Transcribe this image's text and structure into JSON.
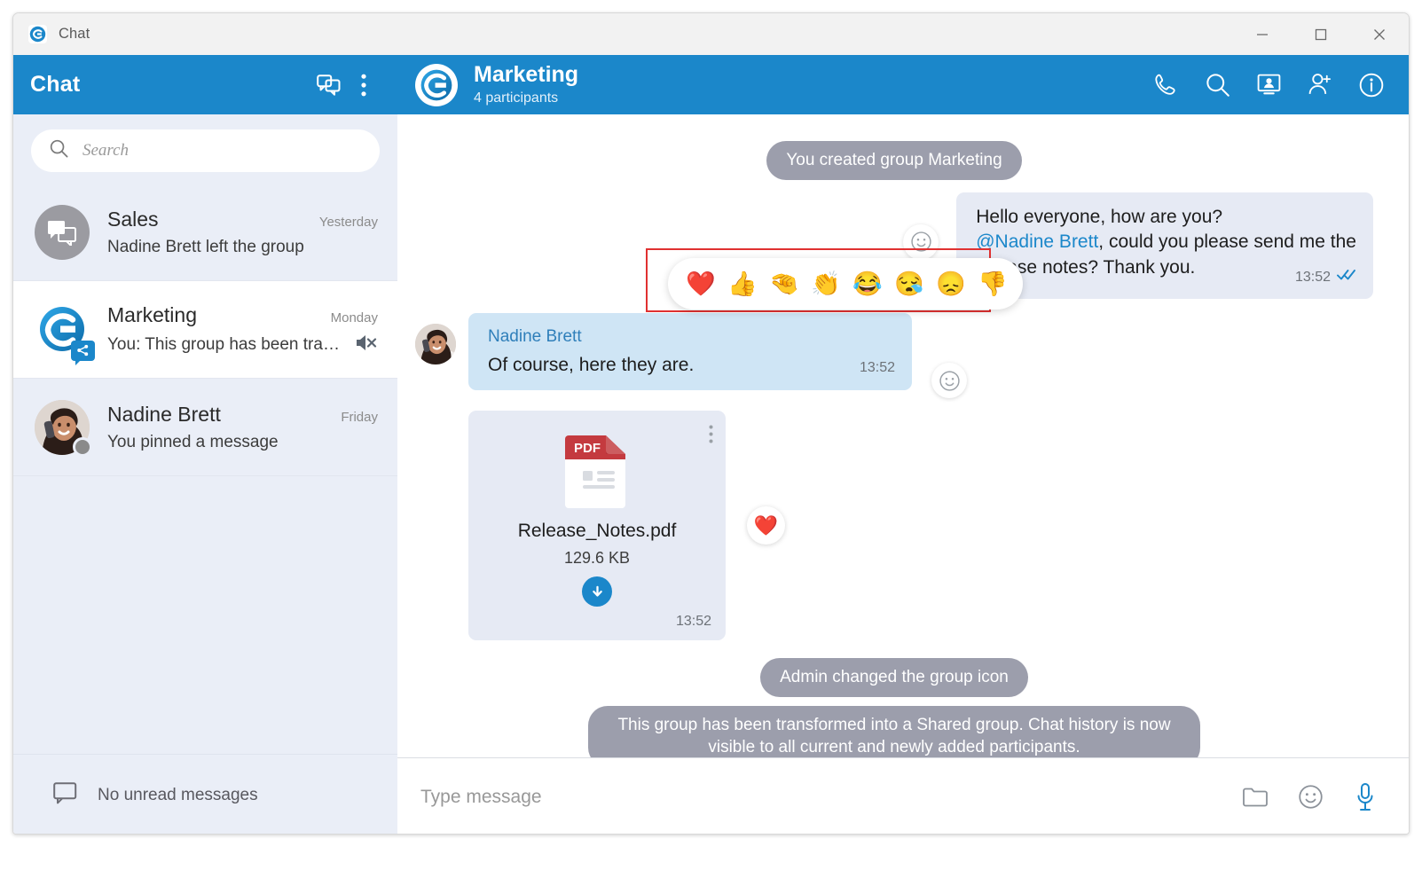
{
  "window": {
    "title": "Chat",
    "app_icon": "chat-g-logo-icon",
    "minimize_label": "Minimize",
    "maximize_label": "Maximize",
    "close_label": "Close"
  },
  "sidebar": {
    "title": "Chat",
    "new_chat_icon": "new-chat-icon",
    "more_icon": "more-vertical-icon",
    "search": {
      "placeholder": "Search",
      "value": "",
      "icon": "search-icon"
    },
    "chats": [
      {
        "name": "Sales",
        "time": "Yesterday",
        "preview": "Nadine Brett left the group",
        "avatar_type": "group-chat-bubbles",
        "active": false,
        "muted": false
      },
      {
        "name": "Marketing",
        "time": "Monday",
        "preview": "You: This group has been tran...",
        "avatar_type": "brand-g-logo",
        "active": true,
        "muted": true,
        "mute_icon": "speaker-mute-icon",
        "badge": "shared-group-icon"
      },
      {
        "name": "Nadine Brett",
        "time": "Friday",
        "preview": "You pinned a message",
        "avatar_type": "photo-woman",
        "active": false,
        "muted": false,
        "presence": "offline"
      }
    ],
    "footer": {
      "icon": "chat-bubble-outline-icon",
      "text": "No unread messages"
    }
  },
  "conversation": {
    "avatar_icon": "brand-g-logo",
    "title": "Marketing",
    "subtitle": "4 participants",
    "actions": [
      {
        "name": "call-icon",
        "label": "Call"
      },
      {
        "name": "search-icon",
        "label": "Search"
      },
      {
        "name": "screen-share-icon",
        "label": "Share screen"
      },
      {
        "name": "add-participant-icon",
        "label": "Add participant"
      },
      {
        "name": "info-icon",
        "label": "Info"
      }
    ],
    "messages": [
      {
        "kind": "system",
        "text": "You created group Marketing"
      },
      {
        "kind": "outgoing",
        "line1": "Hello everyone, how are you?",
        "mention": "@Nadine Brett",
        "line2_rest": ", could you please send me the",
        "line3": "release notes? Thank you.",
        "time": "13:52",
        "status_icon": "double-check-read-icon",
        "react_icon": "smiley-add-reaction-icon"
      },
      {
        "kind": "incoming",
        "sender": "Nadine Brett",
        "text": "Of course, here they are.",
        "time": "13:52",
        "react_icon": "smiley-add-reaction-icon"
      },
      {
        "kind": "file",
        "file_type": "PDF",
        "file_name": "Release_Notes.pdf",
        "file_size": "129.6 KB",
        "time": "13:52",
        "download_icon": "download-icon",
        "kebab_icon": "more-vertical-icon",
        "reaction": "❤️"
      },
      {
        "kind": "system",
        "text": "Admin changed the group icon"
      },
      {
        "kind": "system",
        "text": "This group has been transformed into a Shared group. Chat history is now visible to all current and newly added participants."
      }
    ],
    "emoji_picker": {
      "highlighted": true,
      "options": [
        {
          "glyph": "❤️",
          "name": "heart-reaction"
        },
        {
          "glyph": "👍",
          "name": "thumbs-up-reaction"
        },
        {
          "glyph": "🤏",
          "name": "partial-hand-reaction"
        },
        {
          "glyph": "👏",
          "name": "clap-reaction"
        },
        {
          "glyph": "😂",
          "name": "joy-reaction"
        },
        {
          "glyph": "😪",
          "name": "sleepy-reaction"
        },
        {
          "glyph": "😞",
          "name": "disappointed-reaction"
        },
        {
          "glyph": "👎",
          "name": "thumbs-down-reaction"
        }
      ]
    },
    "composer": {
      "placeholder": "Type message",
      "value": "",
      "actions": [
        {
          "name": "attach-file-icon",
          "label": "Attach file"
        },
        {
          "name": "emoji-icon",
          "label": "Emoji"
        },
        {
          "name": "microphone-icon",
          "label": "Voice message"
        }
      ]
    }
  },
  "colors": {
    "brand_blue": "#1b87ca",
    "sidebar_bg": "#eaeef7",
    "bubble_out": "#e6eaf4",
    "bubble_in": "#cfe5f5",
    "system_bubble": "#9c9eac",
    "highlight_red": "#e03131",
    "pdf_red": "#c43a3f"
  }
}
